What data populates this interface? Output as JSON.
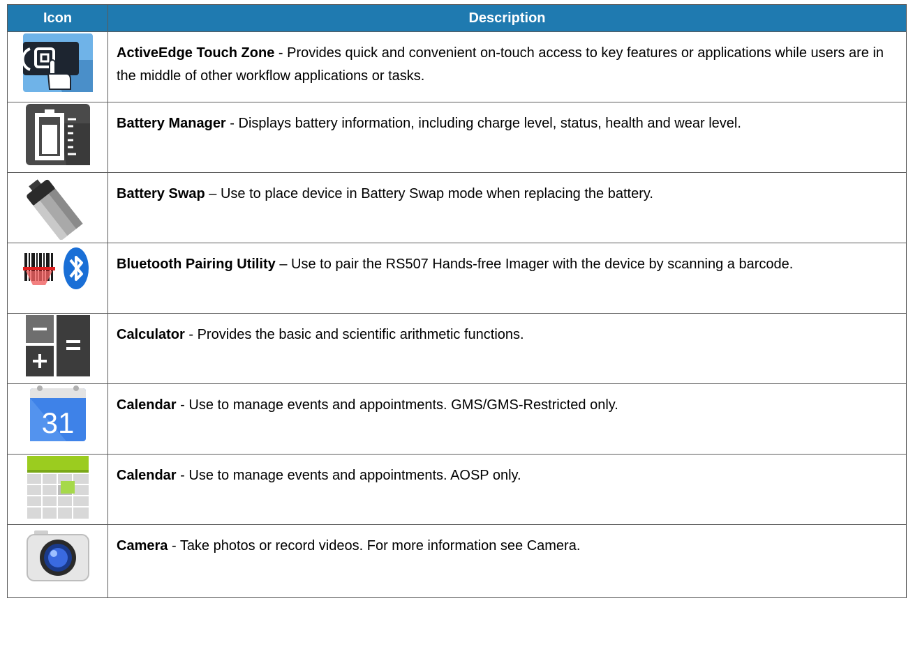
{
  "table": {
    "headers": {
      "icon": "Icon",
      "description": "Description"
    },
    "rows": [
      {
        "icon": "activeedge-touch-zone-icon",
        "name": "ActiveEdge Touch Zone",
        "sep": " - ",
        "text": "Provides quick and convenient on-touch access to key features or applications while users are in the middle of other workflow applications or tasks."
      },
      {
        "icon": "battery-manager-icon",
        "name": "Battery Manager",
        "sep": " - ",
        "text": "Displays battery information, including charge level, status, health and wear level."
      },
      {
        "icon": "battery-swap-icon",
        "name": "Battery Swap",
        "sep": " – ",
        "text": "Use to place device in Battery Swap mode when replacing the battery."
      },
      {
        "icon": "bluetooth-pairing-icon",
        "name": "Bluetooth Pairing Utility",
        "sep": " – ",
        "text": "Use to pair the RS507 Hands-free Imager with the device by scanning a barcode."
      },
      {
        "icon": "calculator-icon",
        "name": "Calculator",
        "sep": " - ",
        "text": "Provides the basic and scientific arithmetic functions."
      },
      {
        "icon": "google-calendar-icon",
        "icon_text": "31",
        "name": "Calendar",
        "sep": " - ",
        "text": "Use to manage events and appointments. GMS/GMS-Restricted only."
      },
      {
        "icon": "aosp-calendar-icon",
        "name": "Calendar",
        "sep": " - ",
        "text": "Use to manage events and appointments. AOSP only."
      },
      {
        "icon": "camera-icon",
        "name": "Camera",
        "sep": " - ",
        "text": "Take photos or record videos. For more information see Camera."
      }
    ]
  },
  "colors": {
    "header_bg": "#1f7ab0",
    "header_text": "#ffffff",
    "border": "#5a5a5a"
  }
}
